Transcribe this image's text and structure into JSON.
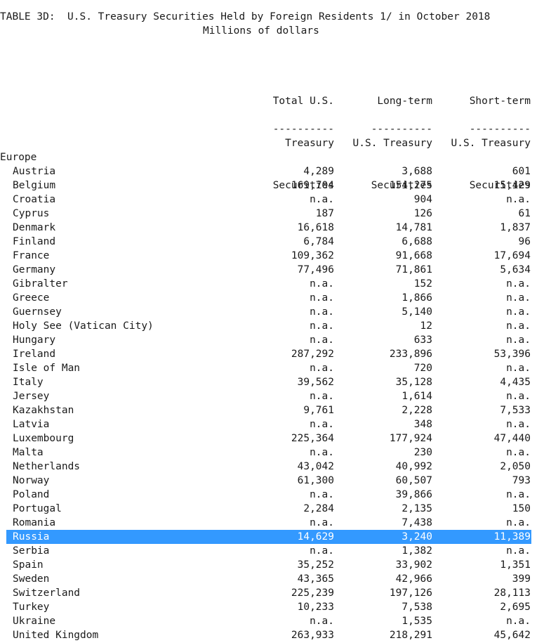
{
  "title_line": "TABLE 3D:  U.S. Treasury Securities Held by Foreign Residents 1/ in October 2018",
  "subtitle_line": "Millions of dollars",
  "headers": {
    "col1": [
      "Total U.S.",
      "Treasury",
      "Securities"
    ],
    "col2": [
      "Long-term",
      "U.S. Treasury",
      "Securities"
    ],
    "col3": [
      "Short-term",
      "U.S. Treasury",
      "Securities"
    ]
  },
  "rule": "----------",
  "region": "Europe",
  "selected_country": "Russia",
  "rows": [
    {
      "country": "Austria",
      "total": "4,289",
      "long": "3,688",
      "short": "601"
    },
    {
      "country": "Belgium",
      "total": "169,704",
      "long": "154,275",
      "short": "15,429"
    },
    {
      "country": "Croatia",
      "total": "n.a.",
      "long": "904",
      "short": "n.a."
    },
    {
      "country": "Cyprus",
      "total": "187",
      "long": "126",
      "short": "61"
    },
    {
      "country": "Denmark",
      "total": "16,618",
      "long": "14,781",
      "short": "1,837"
    },
    {
      "country": "Finland",
      "total": "6,784",
      "long": "6,688",
      "short": "96"
    },
    {
      "country": "France",
      "total": "109,362",
      "long": "91,668",
      "short": "17,694"
    },
    {
      "country": "Germany",
      "total": "77,496",
      "long": "71,861",
      "short": "5,634"
    },
    {
      "country": "Gibralter",
      "total": "n.a.",
      "long": "152",
      "short": "n.a."
    },
    {
      "country": "Greece",
      "total": "n.a.",
      "long": "1,866",
      "short": "n.a."
    },
    {
      "country": "Guernsey",
      "total": "n.a.",
      "long": "5,140",
      "short": "n.a."
    },
    {
      "country": "Holy See (Vatican City)",
      "total": "n.a.",
      "long": "12",
      "short": "n.a."
    },
    {
      "country": "Hungary",
      "total": "n.a.",
      "long": "633",
      "short": "n.a."
    },
    {
      "country": "Ireland",
      "total": "287,292",
      "long": "233,896",
      "short": "53,396"
    },
    {
      "country": "Isle of Man",
      "total": "n.a.",
      "long": "720",
      "short": "n.a."
    },
    {
      "country": "Italy",
      "total": "39,562",
      "long": "35,128",
      "short": "4,435"
    },
    {
      "country": "Jersey",
      "total": "n.a.",
      "long": "1,614",
      "short": "n.a."
    },
    {
      "country": "Kazakhstan",
      "total": "9,761",
      "long": "2,228",
      "short": "7,533"
    },
    {
      "country": "Latvia",
      "total": "n.a.",
      "long": "348",
      "short": "n.a."
    },
    {
      "country": "Luxembourg",
      "total": "225,364",
      "long": "177,924",
      "short": "47,440"
    },
    {
      "country": "Malta",
      "total": "n.a.",
      "long": "230",
      "short": "n.a."
    },
    {
      "country": "Netherlands",
      "total": "43,042",
      "long": "40,992",
      "short": "2,050"
    },
    {
      "country": "Norway",
      "total": "61,300",
      "long": "60,507",
      "short": "793"
    },
    {
      "country": "Poland",
      "total": "n.a.",
      "long": "39,866",
      "short": "n.a."
    },
    {
      "country": "Portugal",
      "total": "2,284",
      "long": "2,135",
      "short": "150"
    },
    {
      "country": "Romania",
      "total": "n.a.",
      "long": "7,438",
      "short": "n.a."
    },
    {
      "country": "Russia",
      "total": "14,629",
      "long": "3,240",
      "short": "11,389"
    },
    {
      "country": "Serbia",
      "total": "n.a.",
      "long": "1,382",
      "short": "n.a."
    },
    {
      "country": "Spain",
      "total": "35,252",
      "long": "33,902",
      "short": "1,351"
    },
    {
      "country": "Sweden",
      "total": "43,365",
      "long": "42,966",
      "short": "399"
    },
    {
      "country": "Switzerland",
      "total": "225,239",
      "long": "197,126",
      "short": "28,113"
    },
    {
      "country": "Turkey",
      "total": "10,233",
      "long": "7,538",
      "short": "2,695"
    },
    {
      "country": "Ukraine",
      "total": "n.a.",
      "long": "1,535",
      "short": "n.a."
    },
    {
      "country": "United Kingdom",
      "total": "263,933",
      "long": "218,291",
      "short": "45,642"
    }
  ],
  "colors": {
    "selection": "#3399ff",
    "text": "#1a1a1a",
    "background": "#ffffff"
  }
}
